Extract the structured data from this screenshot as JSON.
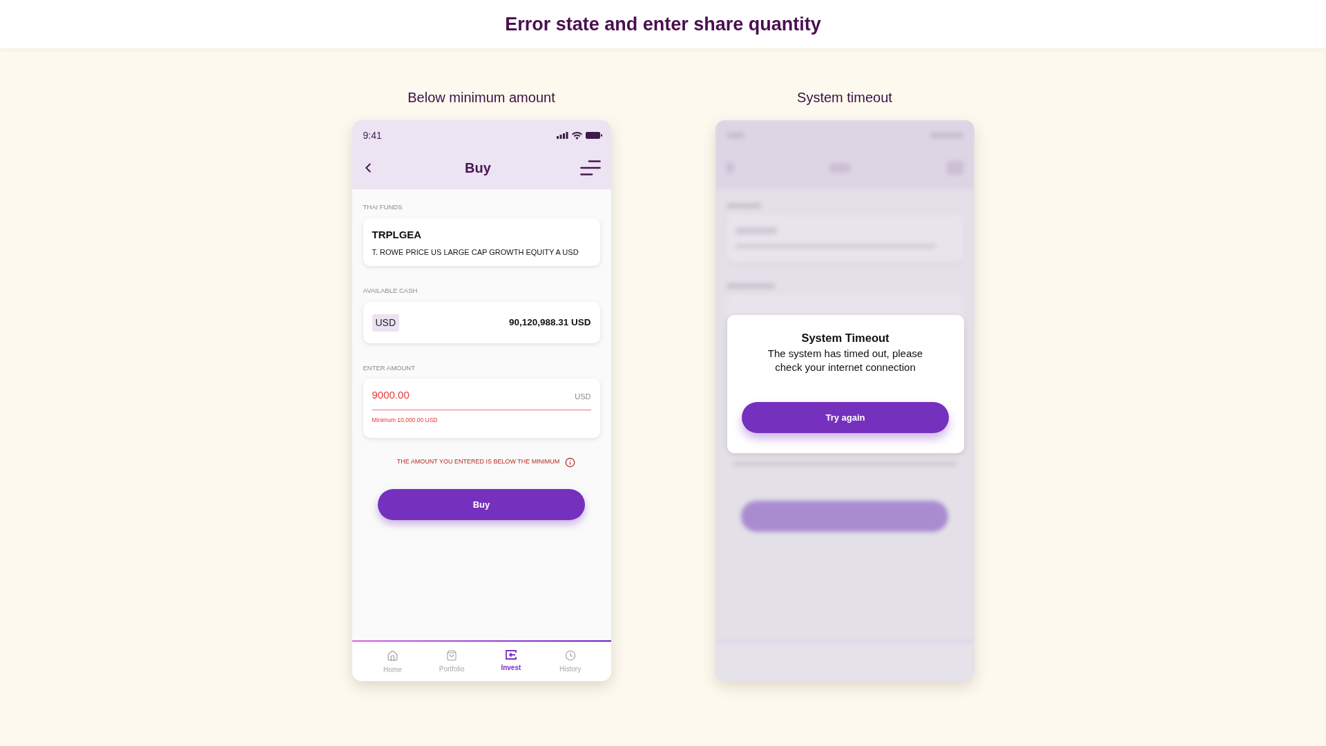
{
  "page_title": "Error state and enter share quantity",
  "screens": [
    {
      "kind": "form",
      "caption": "Below minimum amount",
      "status_bar": {
        "time": "9:41"
      },
      "header": {
        "title": "Buy"
      },
      "fund": {
        "label": "THAI FUNDS",
        "code": "TRPLGEA",
        "name": "T. ROWE PRICE US LARGE CAP GROWTH EQUITY A USD"
      },
      "cash": {
        "label": "AVAILABLE CASH",
        "currency": "USD",
        "amount": "90,120,988.31 USD"
      },
      "amount": {
        "label": "ENTER AMOUNT",
        "value": "9000.00",
        "unit": "USD",
        "error": true,
        "hint": "Minimum 10,000.00 USD"
      },
      "error_message": "THE AMOUNT YOU ENTERED IS BELOW THE MINIMUM",
      "button": "Buy",
      "tabs": [
        {
          "label": "Home",
          "selected": false
        },
        {
          "label": "Portfolio",
          "selected": false
        },
        {
          "label": "Invest",
          "selected": true
        },
        {
          "label": "History",
          "selected": false
        }
      ]
    },
    {
      "kind": "dialog",
      "caption": "System timeout",
      "dialog": {
        "title": "System Timeout",
        "message": "The system has timed out, please check your internet connection",
        "button": "Try again"
      }
    }
  ]
}
